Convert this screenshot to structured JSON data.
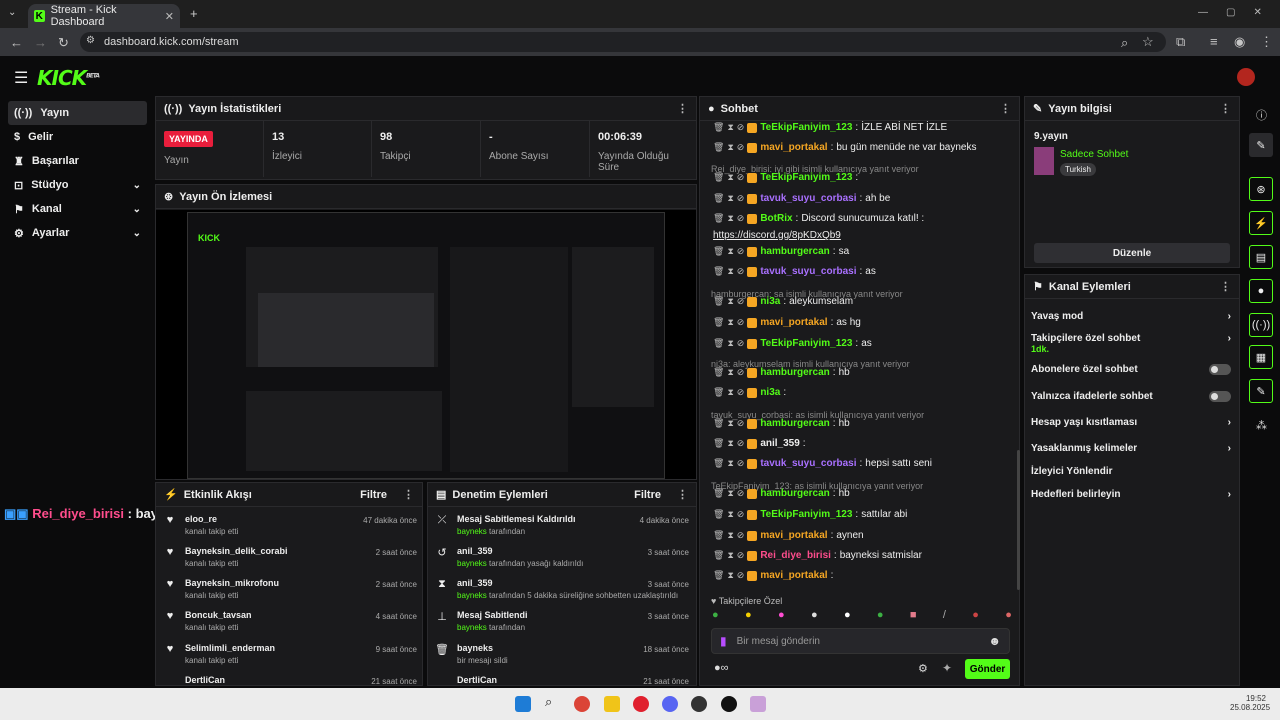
{
  "browser": {
    "tab_title": "Stream - Kick Dashboard",
    "url": "dashboard.kick.com/stream"
  },
  "app": {
    "logo": "KICK",
    "logo_sup": "BETA"
  },
  "sidebar": [
    {
      "label": "Yayın"
    },
    {
      "label": "Gelir"
    },
    {
      "label": "Başarılar"
    },
    {
      "label": "Stüdyo"
    },
    {
      "label": "Kanal"
    },
    {
      "label": "Ayarlar"
    }
  ],
  "stats": {
    "title": "Yayın İstatistikleri",
    "live": "YAYINDA",
    "live_label": "Yayın",
    "viewers": "13",
    "viewers_label": "İzleyici",
    "followers": "98",
    "followers_label": "Takipçi",
    "subs": "-",
    "subs_label": "Abone Sayısı",
    "duration": "00:06:39",
    "duration_label": "Yayında Olduğu Süre"
  },
  "preview": {
    "title": "Yayın Ön İzlemesi"
  },
  "overlay": {
    "user": "Rei_diye_birisi",
    "sep": ":",
    "text": "bayneksi satmislar"
  },
  "activity": {
    "title": "Etkinlik Akışı",
    "filter": "Filtre",
    "rows": [
      {
        "name": "eloo_re",
        "sub": "kanalı takip etti",
        "time": "47 dakika önce"
      },
      {
        "name": "Bayneksin_delik_corabi",
        "sub": "kanalı takip etti",
        "time": "2 saat önce"
      },
      {
        "name": "Bayneksin_mikrofonu",
        "sub": "kanalı takip etti",
        "time": "2 saat önce"
      },
      {
        "name": "Boncuk_tavsan",
        "sub": "kanalı takip etti",
        "time": "4 saat önce"
      },
      {
        "name": "Selimlimli_enderman",
        "sub": "kanalı takip etti",
        "time": "9 saat önce"
      },
      {
        "name": "DertliCan",
        "sub": "",
        "time": "21 saat önce"
      }
    ]
  },
  "mod": {
    "title": "Denetim Eylemleri",
    "filter": "Filtre",
    "rows": [
      {
        "name": "Mesaj Sabitlemesi Kaldırıldı",
        "by": "bayneks",
        "sub": "tarafından",
        "time": "4 dakika önce"
      },
      {
        "name": "anil_359",
        "by": "bayneks",
        "sub": "tarafından yasağı kaldırıldı",
        "time": "3 saat önce"
      },
      {
        "name": "anil_359",
        "by": "bayneks",
        "sub": "tarafından 5 dakika süreliğine sohbetten uzaklaştırıldı",
        "time": "3 saat önce"
      },
      {
        "name": "Mesaj Sabitlendi",
        "by": "bayneks",
        "sub": "tarafından",
        "time": "3 saat önce"
      },
      {
        "name": "bayneks",
        "by": "",
        "sub": "bir mesajı sildi",
        "time": "18 saat önce"
      },
      {
        "name": "DertliCan",
        "by": "",
        "sub": "",
        "time": "21 saat önce"
      }
    ]
  },
  "chat": {
    "title": "Sohbet",
    "messages": [
      {
        "user": "TeEkipFaniyim_123",
        "color": "#53fc18",
        "text": "İZLE ABİ NET İZLE"
      },
      {
        "user": "mavi_portakal",
        "color": "#f5a623",
        "text": "bu gün menüde ne var bayneks"
      },
      {
        "reply": "Rei_diye_birisi: iyi gibi isimli kullanıcıya yanıt veriyor"
      },
      {
        "user": "TeEkipFaniyim_123",
        "color": "#53fc18",
        "text": ""
      },
      {
        "user": "tavuk_suyu_corbasi",
        "color": "#a970ff",
        "text": "ah be"
      },
      {
        "user": "BotRix",
        "color": "#53fc18",
        "text": "Discord sunucumuza katıl! :"
      },
      {
        "link": "https://discord.gg/8pKDxQb9"
      },
      {
        "user": "hamburgercan",
        "color": "#53fc18",
        "text": "sa"
      },
      {
        "user": "tavuk_suyu_corbasi",
        "color": "#a970ff",
        "text": "as"
      },
      {
        "reply": "hamburgercan: sa isimli kullanıcıya yanıt veriyor"
      },
      {
        "user": "ni3a",
        "color": "#53fc18",
        "text": "aleykumselam"
      },
      {
        "user": "mavi_portakal",
        "color": "#f5a623",
        "text": "as hg"
      },
      {
        "user": "TeEkipFaniyim_123",
        "color": "#53fc18",
        "text": "as"
      },
      {
        "reply": "ni3a: aleykumselam isimli kullanıcıya yanıt veriyor"
      },
      {
        "user": "hamburgercan",
        "color": "#53fc18",
        "text": "hb"
      },
      {
        "user": "ni3a",
        "color": "#53fc18",
        "text": ""
      },
      {
        "reply": "tavuk_suyu_corbasi: as isimli kullanıcıya yanıt veriyor"
      },
      {
        "user": "hamburgercan",
        "color": "#53fc18",
        "text": "hb"
      },
      {
        "user": "anil_359",
        "color": "#eeeeee",
        "text": ""
      },
      {
        "user": "tavuk_suyu_corbasi",
        "color": "#a970ff",
        "text": "hepsi sattı seni"
      },
      {
        "reply": "TeEkipFaniyim_123: as isimli kullanıcıya yanıt veriyor"
      },
      {
        "user": "hamburgercan",
        "color": "#53fc18",
        "text": "hb"
      },
      {
        "user": "TeEkipFaniyim_123",
        "color": "#53fc18",
        "text": "sattılar abi"
      },
      {
        "user": "mavi_portakal",
        "color": "#f5a623",
        "text": "aynen"
      },
      {
        "user": "Rei_diye_birisi",
        "color": "#ff4d8d",
        "text": "bayneksi satmislar"
      },
      {
        "user": "mavi_portakal",
        "color": "#f5a623",
        "text": ""
      }
    ],
    "emote_label": "Takipçilere Özel",
    "placeholder": "Bir mesaj gönderin",
    "send": "Gönder"
  },
  "info": {
    "title": "Yayın bilgisi",
    "stream_title": "9.yayın",
    "category": "Sadece Sohbet",
    "language": "Turkish",
    "edit": "Düzenle"
  },
  "actions": {
    "title": "Kanal Eylemleri",
    "items": [
      {
        "label": "Yavaş mod",
        "extra": ""
      },
      {
        "label": "Takipçilere özel sohbet",
        "extra": "1dk."
      },
      {
        "label": "Abonelere özel sohbet",
        "extra": ""
      },
      {
        "label": "Yalnızca ifadelerle sohbet",
        "extra": ""
      },
      {
        "label": "Hesap yaşı kısıtlaması",
        "extra": ""
      },
      {
        "label": "Yasaklanmış kelimeler",
        "extra": ""
      },
      {
        "label": "İzleyici Yönlendir",
        "extra": ""
      },
      {
        "label": "Hedefleri belirleyin",
        "extra": ""
      }
    ]
  },
  "clock": {
    "time": "19:52",
    "date": "25.08.2025"
  }
}
